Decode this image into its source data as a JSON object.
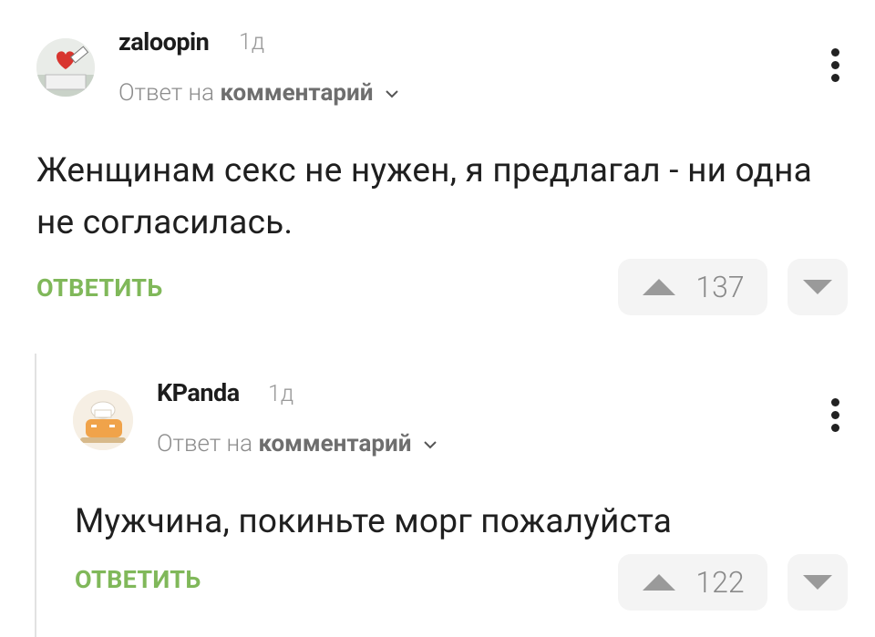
{
  "comments": [
    {
      "username": "zaloopin",
      "age": "1д",
      "reply_prefix": "Ответ на",
      "reply_link": "комментарий",
      "text": "Женщинам секс не нужен, я предлагал - ни одна не согласилась.",
      "reply_label": "ОТВЕТИТЬ",
      "score": "137",
      "avatar_icon": "heart-sign-avatar"
    },
    {
      "username": "KPanda",
      "age": "1д",
      "reply_prefix": "Ответ на",
      "reply_link": "комментарий",
      "text": "Мужчина, покиньте морг пожалуйста",
      "reply_label": "ОТВЕТИТЬ",
      "score": "122",
      "avatar_icon": "chef-hat-avatar"
    }
  ],
  "icons": {
    "upvote": "triangle-up-icon",
    "downvote": "triangle-down-icon",
    "menu": "kebab-menu-icon",
    "expand": "chevron-down-icon"
  },
  "colors": {
    "reply_green": "#80b85a",
    "vote_bg": "#f4f4f4",
    "muted": "#8c8c8c",
    "thread_line": "#e2e2e2"
  }
}
